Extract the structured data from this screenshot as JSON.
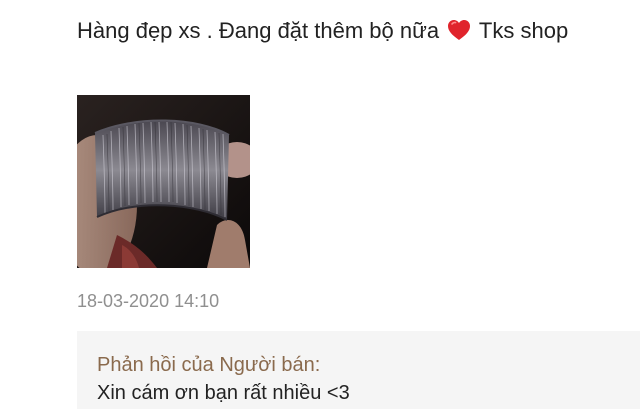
{
  "review": {
    "text_before_emoji": "Hàng đẹp xs . Đang đặt thêm bộ nữa",
    "emoji": "heart-icon",
    "text_after_emoji": "Tks shop",
    "photo_icon": "bangles-photo",
    "timestamp": "18-03-2020 14:10"
  },
  "seller_reply": {
    "title": "Phản hồi của Người bán:",
    "text": "Xin cám ơn bạn rất nhiều <3"
  },
  "colors": {
    "heart": "#e0242c",
    "reply_title": "#8a6a4d",
    "timestamp": "#8f8f8f",
    "reply_background": "#f5f5f5"
  }
}
